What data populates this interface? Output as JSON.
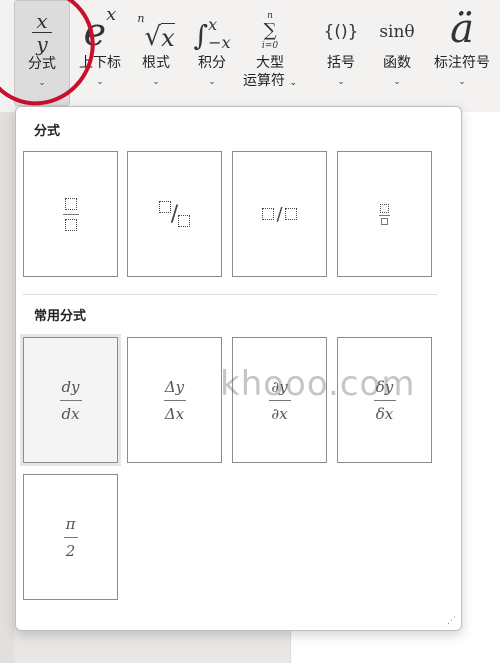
{
  "ribbon": {
    "fraction": {
      "icon_top": "x",
      "icon_bottom": "y",
      "label": "分式"
    },
    "script": {
      "icon_base": "e",
      "icon_sup": "x",
      "label": "上下标"
    },
    "radical": {
      "icon_index": "n",
      "icon_radicand": "x",
      "label": "根式"
    },
    "integral": {
      "icon_sign": "∫",
      "icon_upper": "x",
      "icon_lower": "−x",
      "label": "积分"
    },
    "large_operator": {
      "icon_upper": "n",
      "icon_sign": "∑",
      "icon_lower": "i=0",
      "label_line1": "大型",
      "label_line2": "运算符"
    },
    "bracket": {
      "icon": "{()}",
      "label": "括号"
    },
    "function": {
      "icon": "sinθ",
      "label": "函数"
    },
    "accent": {
      "icon": "ä",
      "label": "标注符号"
    },
    "chevron": "⌄"
  },
  "panel": {
    "section1_title": "分式",
    "section2_title": "常用分式",
    "slash_char": "/",
    "common": [
      {
        "num": "dy",
        "den": "dx"
      },
      {
        "num": "Δy",
        "den": "Δx"
      },
      {
        "num": "∂y",
        "den": "∂x"
      },
      {
        "num": "δy",
        "den": "δx"
      },
      {
        "num": "π",
        "den": "2"
      }
    ],
    "resize_grip": "⋰"
  },
  "watermark": "khooo.com"
}
